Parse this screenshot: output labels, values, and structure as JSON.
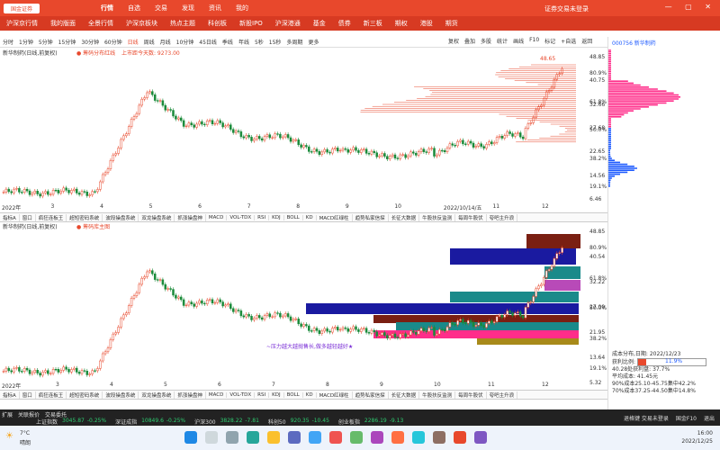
{
  "app": {
    "logo": "国金证券",
    "nav": [
      "行情",
      "自选",
      "交易",
      "发现",
      "资讯",
      "我的"
    ],
    "login": "证券交易未登录",
    "window_controls": "— ▢ ✕"
  },
  "menu": [
    "沪深京行情",
    "我的版面",
    "全景行情",
    "沪深京板块",
    "热点主题",
    "科创板",
    "新股IPO",
    "沪深港通",
    "基金",
    "债券",
    "新三板",
    "期权",
    "港股",
    "期货"
  ],
  "periods": [
    "分时",
    "1分钟",
    "5分钟",
    "15分钟",
    "30分钟",
    "60分钟",
    "日线",
    "周线",
    "月线",
    "10分钟",
    "45日线",
    "季线",
    "年线",
    "5秒",
    "15秒",
    "多周期",
    "更多"
  ],
  "active_period": "日线",
  "toolbar": [
    "复权",
    "叠加",
    "多股",
    "统计",
    "画线",
    "F10",
    "标记",
    "+自选",
    "返回"
  ],
  "top_chart": {
    "title": "新华制药(日线,前复权)",
    "subtitle1": "● 筹码分布红线",
    "subtitle2": "上市距今天数: 9273.00",
    "prices": [
      "48.85",
      "40.75",
      "32.66",
      "27.68",
      "22.65",
      "14.56",
      "6.46"
    ],
    "pcts": [
      "80.9%",
      "61.8%",
      "50.0%",
      "38.2%",
      "19.1%"
    ],
    "highlow_label": "48.65",
    "dates": [
      "2022年",
      "3",
      "4",
      "5",
      "6",
      "7",
      "8",
      "9",
      "10",
      "2022/10/14/五",
      "11",
      "12"
    ]
  },
  "indicators": [
    "指标A",
    "窗口",
    "疯狂连板王",
    "超短密码系统",
    "波段操盘系统",
    "双龙操盘系统",
    "抓涨操盘神",
    "MACD",
    "VOL-TDX",
    "RSI",
    "KDJ",
    "BOLL",
    "KD",
    "MACD红绿柱",
    "趋势私家信探",
    "长征大数据",
    "牛股扶反监测",
    "每周牛股伏",
    "夸吧主升浪",
    "指标B",
    "模板"
  ],
  "bottom_chart": {
    "title": "新华制药(日线,前复权)",
    "subtitle": "● 筹码库主图",
    "prices": [
      "48.85",
      "40.54",
      "32.22",
      "27.09",
      "21.95",
      "13.64",
      "5.32"
    ],
    "pcts": [
      "80.9%",
      "61.8%",
      "50.0%",
      "38.2%",
      "19.1%"
    ],
    "annotation": "~压力越大越抛售长,做多越轻越好★",
    "dates": [
      "2022年",
      "3",
      "4",
      "5",
      "6",
      "7",
      "8",
      "9",
      "10",
      "11",
      "12"
    ]
  },
  "right_panel": {
    "stock": "000756 新华制药",
    "cost_date": "成本分布,日期: 2022/12/23",
    "profit_ratio_label": "获利比例:",
    "profit_ratio": "11.9%",
    "profit_ratio_fill": 0.119,
    "stats": [
      "40.28处获利盘: 37.7%",
      "平均成本: 41.45元",
      "90%成本25.10-45.75集中42.2%",
      "70%成本37.25-44.50集中14.8%"
    ]
  },
  "status_bar": {
    "tabs": [
      "扩展",
      "关联报价",
      "交易委托"
    ],
    "indices": [
      {
        "name": "上证指数",
        "value": "3045.87",
        "change": "-0.25%"
      },
      {
        "name": "深证成指",
        "value": "10849.6",
        "change": "-0.25%"
      },
      {
        "name": "沪深300",
        "value": "3828.22",
        "change": "-7.81"
      },
      {
        "name": "科创50",
        "value": "920.35",
        "change": "-10.45"
      },
      {
        "name": "创业板指",
        "value": "2286.19",
        "change": "-9.13"
      }
    ],
    "right_items": [
      "退格键 交易未登录",
      "国金F10",
      "退出"
    ]
  },
  "taskbar": {
    "weather": "7°C",
    "weather_desc": "晴朗",
    "time": "16:00",
    "date": "2022/12/25"
  },
  "colors": {
    "brand": "#e8482c",
    "up": "#e8482c",
    "down": "#1a8a3a",
    "pink": "#ff2d8a",
    "blue": "#1e5bff"
  }
}
